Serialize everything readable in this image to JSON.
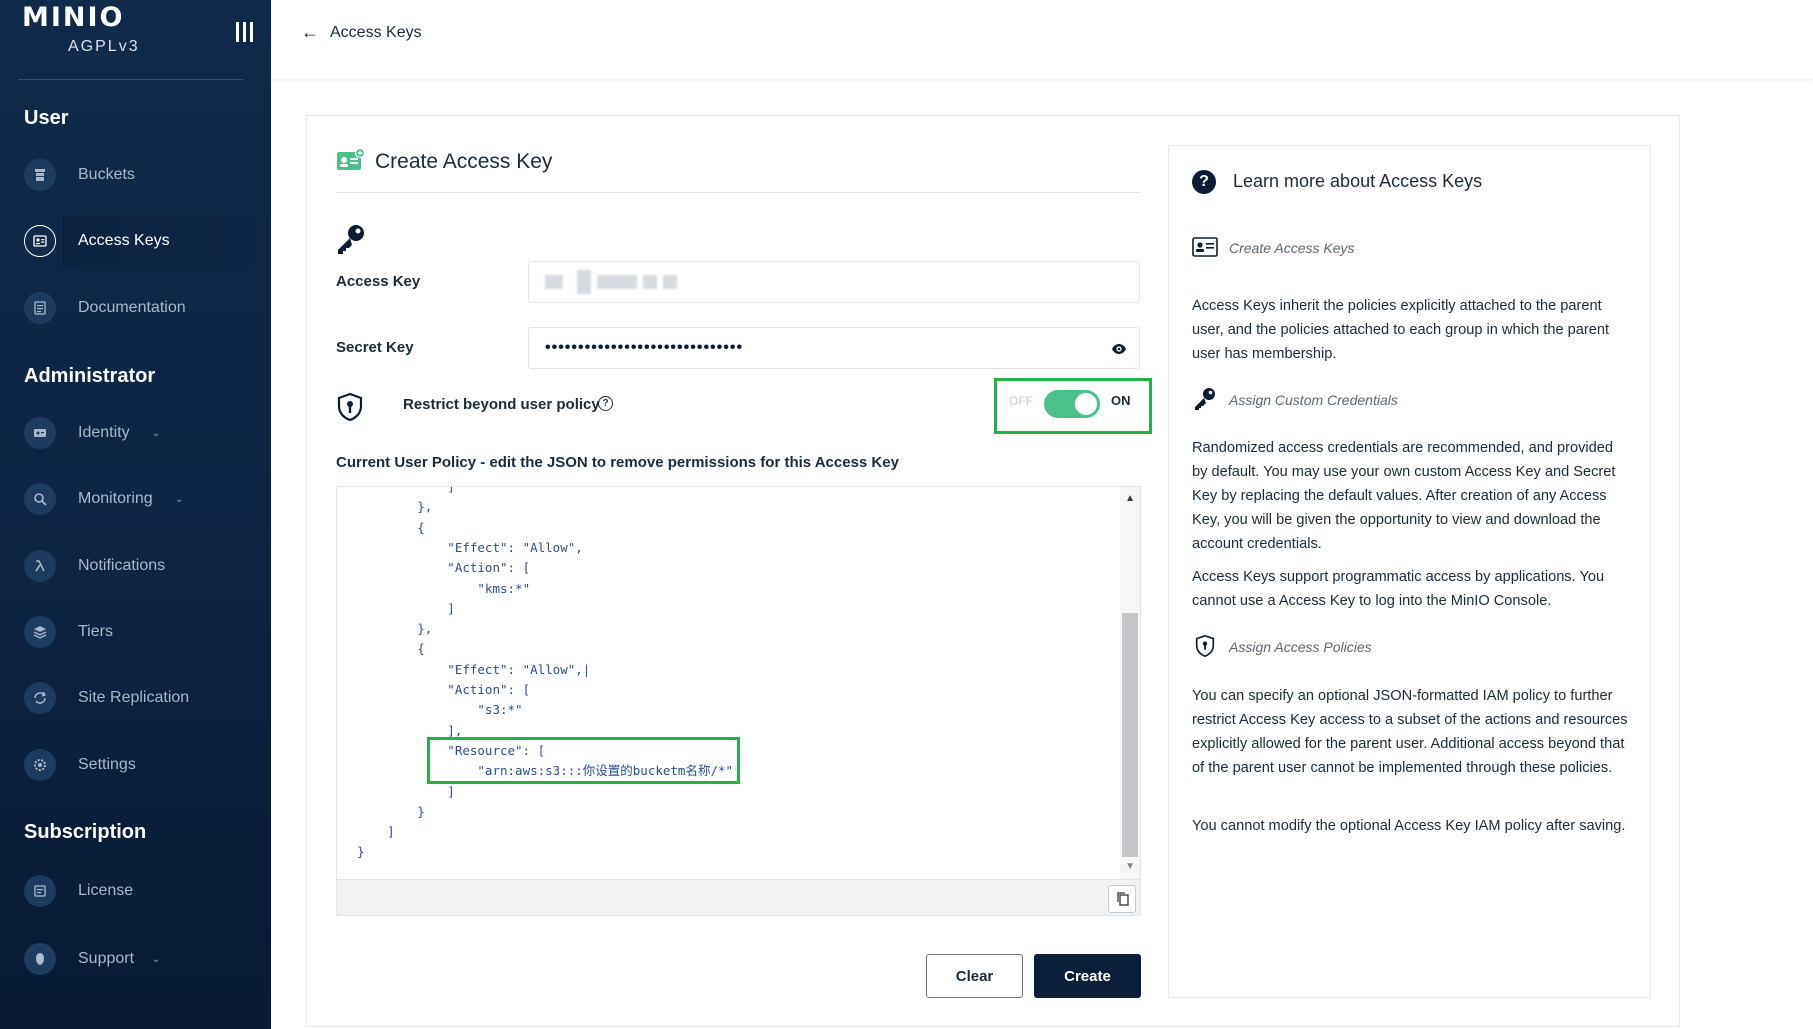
{
  "sidebar": {
    "logo": "MINIO",
    "license": "AGPLv3",
    "sections": {
      "user": "User",
      "administrator": "Administrator",
      "subscription": "Subscription"
    },
    "items": {
      "buckets": "Buckets",
      "access_keys": "Access Keys",
      "documentation": "Documentation",
      "identity": "Identity",
      "monitoring": "Monitoring",
      "notifications": "Notifications",
      "tiers": "Tiers",
      "site_replication": "Site Replication",
      "settings": "Settings",
      "license": "License",
      "support": "Support"
    },
    "chevron": "⌄"
  },
  "header": {
    "back_arrow": "←",
    "breadcrumb": "Access Keys"
  },
  "form": {
    "title": "Create Access Key",
    "access_key_label": "Access Key",
    "secret_key_label": "Secret Key",
    "secret_key_value": "••••••••••••••••••••••••••••••",
    "restrict_label": "Restrict beyond user policy",
    "help_mark": "?",
    "toggle_off": "OFF",
    "toggle_on": "ON",
    "toggle_state": true,
    "policy_label": "Current User Policy - edit the JSON to remove permissions for this Access Key",
    "policy_lines": [
      "            ]",
      "        },",
      "        {",
      "            \"Effect\": \"Allow\",",
      "            \"Action\": [",
      "                \"kms:*\"",
      "            ]",
      "        },",
      "        {",
      "            \"Effect\": \"Allow\",|",
      "            \"Action\": [",
      "                \"s3:*\"",
      "            ],",
      "            \"Resource\": [",
      "                \"arn:aws:s3:::你设置的bucketm名称/*\"",
      "            ]",
      "        }",
      "    ]",
      "}"
    ],
    "scroll_up": "▲",
    "scroll_down": "▼",
    "clear_label": "Clear",
    "create_label": "Create"
  },
  "help": {
    "title": "Learn more about Access Keys",
    "q_mark": "?",
    "create_heading": "Create Access Keys",
    "create_text": "Access Keys inherit the policies explicitly attached to the parent user, and the policies attached to each group in which the parent user has membership.",
    "custom_heading": "Assign Custom Credentials",
    "custom_text1": "Randomized access credentials are recommended, and provided by default. You may use your own custom Access Key and Secret Key by replacing the default values. After creation of any Access Key, you will be given the opportunity to view and download the account credentials.",
    "custom_text2": "Access Keys support programmatic access by applications. You cannot use a Access Key to log into the MinIO Console.",
    "policies_heading": "Assign Access Policies",
    "policies_text1": "You can specify an optional JSON-formatted IAM policy to further restrict Access Key access to a subset of the actions and resources explicitly allowed for the parent user. Additional access beyond that of the parent user cannot be implemented through these policies.",
    "policies_text2": "You cannot modify the optional Access Key IAM policy after saving."
  },
  "colors": {
    "sidebar_bg": "#0f2a4a",
    "accent_green": "#4cc08a",
    "highlight_green": "#22b14c",
    "primary_button": "#0b1f3a"
  }
}
